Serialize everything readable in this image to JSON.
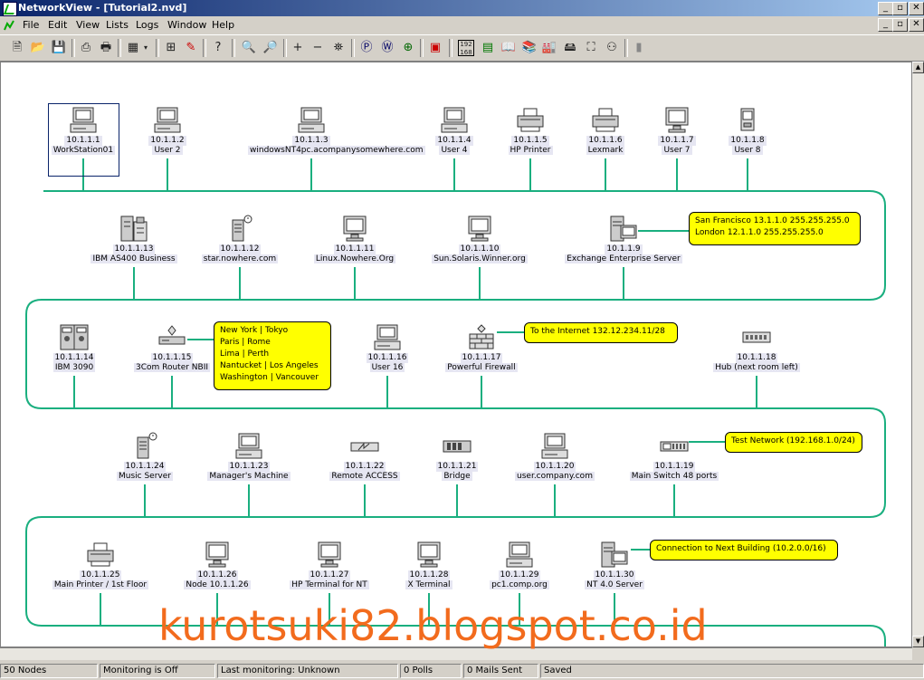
{
  "window": {
    "title": "NetworkView - [Tutorial2.nvd]"
  },
  "menu": {
    "items": [
      "File",
      "Edit",
      "View",
      "Lists",
      "Logs",
      "Window",
      "Help"
    ]
  },
  "toolbar": {
    "icons": [
      "new-icon",
      "open-icon",
      "save-icon",
      "preview-icon",
      "print-icon",
      "layout-icon",
      "dropdown-icon",
      "node-icon",
      "paint-icon",
      "help-icon",
      "zoom-in-icon",
      "zoom-out-icon",
      "add-icon",
      "remove-icon",
      "find-icon",
      "ping-icon",
      "web-icon",
      "scan-icon",
      "monitor-icon",
      "ip-icon",
      "card-icon",
      "book-icon",
      "books-icon",
      "factory-icon",
      "device-icon",
      "save-disk-icon",
      "network-icon",
      "tree-icon",
      "disabled-icon"
    ]
  },
  "nodes": [
    {
      "ip": "10.1.1.1",
      "name": "WorkStation01",
      "icon": "workstation-icon"
    },
    {
      "ip": "10.1.1.2",
      "name": "User 2",
      "icon": "workstation-icon"
    },
    {
      "ip": "10.1.1.3",
      "name": "windowsNT4pc.acompanysomewhere.com",
      "icon": "workstation-icon"
    },
    {
      "ip": "10.1.1.4",
      "name": "User 4",
      "icon": "workstation-icon"
    },
    {
      "ip": "10.1.1.5",
      "name": "HP Printer",
      "icon": "printer-icon"
    },
    {
      "ip": "10.1.1.6",
      "name": "Lexmark",
      "icon": "printer-icon"
    },
    {
      "ip": "10.1.1.7",
      "name": "User 7",
      "icon": "monitor-icon"
    },
    {
      "ip": "10.1.1.8",
      "name": "User 8",
      "icon": "handheld-icon"
    },
    {
      "ip": "10.1.1.13",
      "name": "IBM AS400 Business",
      "icon": "mainframe-icon"
    },
    {
      "ip": "10.1.1.12",
      "name": "star.nowhere.com",
      "icon": "server-clock-icon"
    },
    {
      "ip": "10.1.1.11",
      "name": "Linux.Nowhere.Org",
      "icon": "monitor-icon"
    },
    {
      "ip": "10.1.1.10",
      "name": "Sun.Solaris.Winner.org",
      "icon": "monitor-icon"
    },
    {
      "ip": "10.1.1.9",
      "name": "Exchange Enterprise Server",
      "icon": "server-icon"
    },
    {
      "ip": "10.1.1.14",
      "name": "IBM 3090",
      "icon": "tape-drive-icon"
    },
    {
      "ip": "10.1.1.15",
      "name": "3Com Router NBII",
      "icon": "router-icon"
    },
    {
      "ip": "10.1.1.16",
      "name": "User 16",
      "icon": "workstation-icon"
    },
    {
      "ip": "10.1.1.17",
      "name": "Powerful Firewall",
      "icon": "firewall-icon"
    },
    {
      "ip": "10.1.1.18",
      "name": "Hub (next room left)",
      "icon": "hub-icon"
    },
    {
      "ip": "10.1.1.24",
      "name": "Music Server",
      "icon": "server-clock-icon"
    },
    {
      "ip": "10.1.1.23",
      "name": "Manager's Machine",
      "icon": "workstation-icon"
    },
    {
      "ip": "10.1.1.22",
      "name": "Remote ACCESS",
      "icon": "access-icon"
    },
    {
      "ip": "10.1.1.21",
      "name": "Bridge",
      "icon": "bridge-icon"
    },
    {
      "ip": "10.1.1.20",
      "name": "user.company.com",
      "icon": "workstation-icon"
    },
    {
      "ip": "10.1.1.19",
      "name": "Main Switch 48 ports",
      "icon": "switch-icon"
    },
    {
      "ip": "10.1.1.25",
      "name": "Main Printer / 1st Floor",
      "icon": "printer-icon"
    },
    {
      "ip": "10.1.1.26",
      "name": "Node 10.1.1.26",
      "icon": "monitor-icon"
    },
    {
      "ip": "10.1.1.27",
      "name": "HP Terminal for NT",
      "icon": "monitor-icon"
    },
    {
      "ip": "10.1.1.28",
      "name": "X Terminal",
      "icon": "monitor-icon"
    },
    {
      "ip": "10.1.1.29",
      "name": "pc1.comp.org",
      "icon": "workstation-icon"
    },
    {
      "ip": "10.1.1.30",
      "name": "NT 4.0 Server",
      "icon": "server-icon"
    }
  ],
  "notes": [
    {
      "lines": [
        "San Francisco 13.1.1.0 255.255.255.0",
        "London 12.1.1.0 255.255.255.0"
      ]
    },
    {
      "lines": [
        "New York  |  Tokyo",
        "Paris  |  Rome",
        "Lima  |  Perth",
        "Nantucket  |  Los Angeles",
        "Washington  |  Vancouver"
      ]
    },
    {
      "lines": [
        "To the Internet 132.12.234.11/28"
      ]
    },
    {
      "lines": [
        "Test Network (192.168.1.0/24)"
      ]
    },
    {
      "lines": [
        "Connection to Next Building (10.2.0.0/16)"
      ]
    }
  ],
  "watermark": "kurotsuki82.blogspot.co.id",
  "status": {
    "nodes": "50 Nodes",
    "monitoring": "Monitoring is Off",
    "last": "Last monitoring: Unknown",
    "polls": "0 Polls",
    "mails": "0 Mails Sent",
    "saved": "Saved"
  },
  "colors": {
    "wire": "#1aaf7f",
    "note": "#ffff00",
    "label_bg": "#e6e6f2",
    "title_bar": "#0a246a"
  }
}
